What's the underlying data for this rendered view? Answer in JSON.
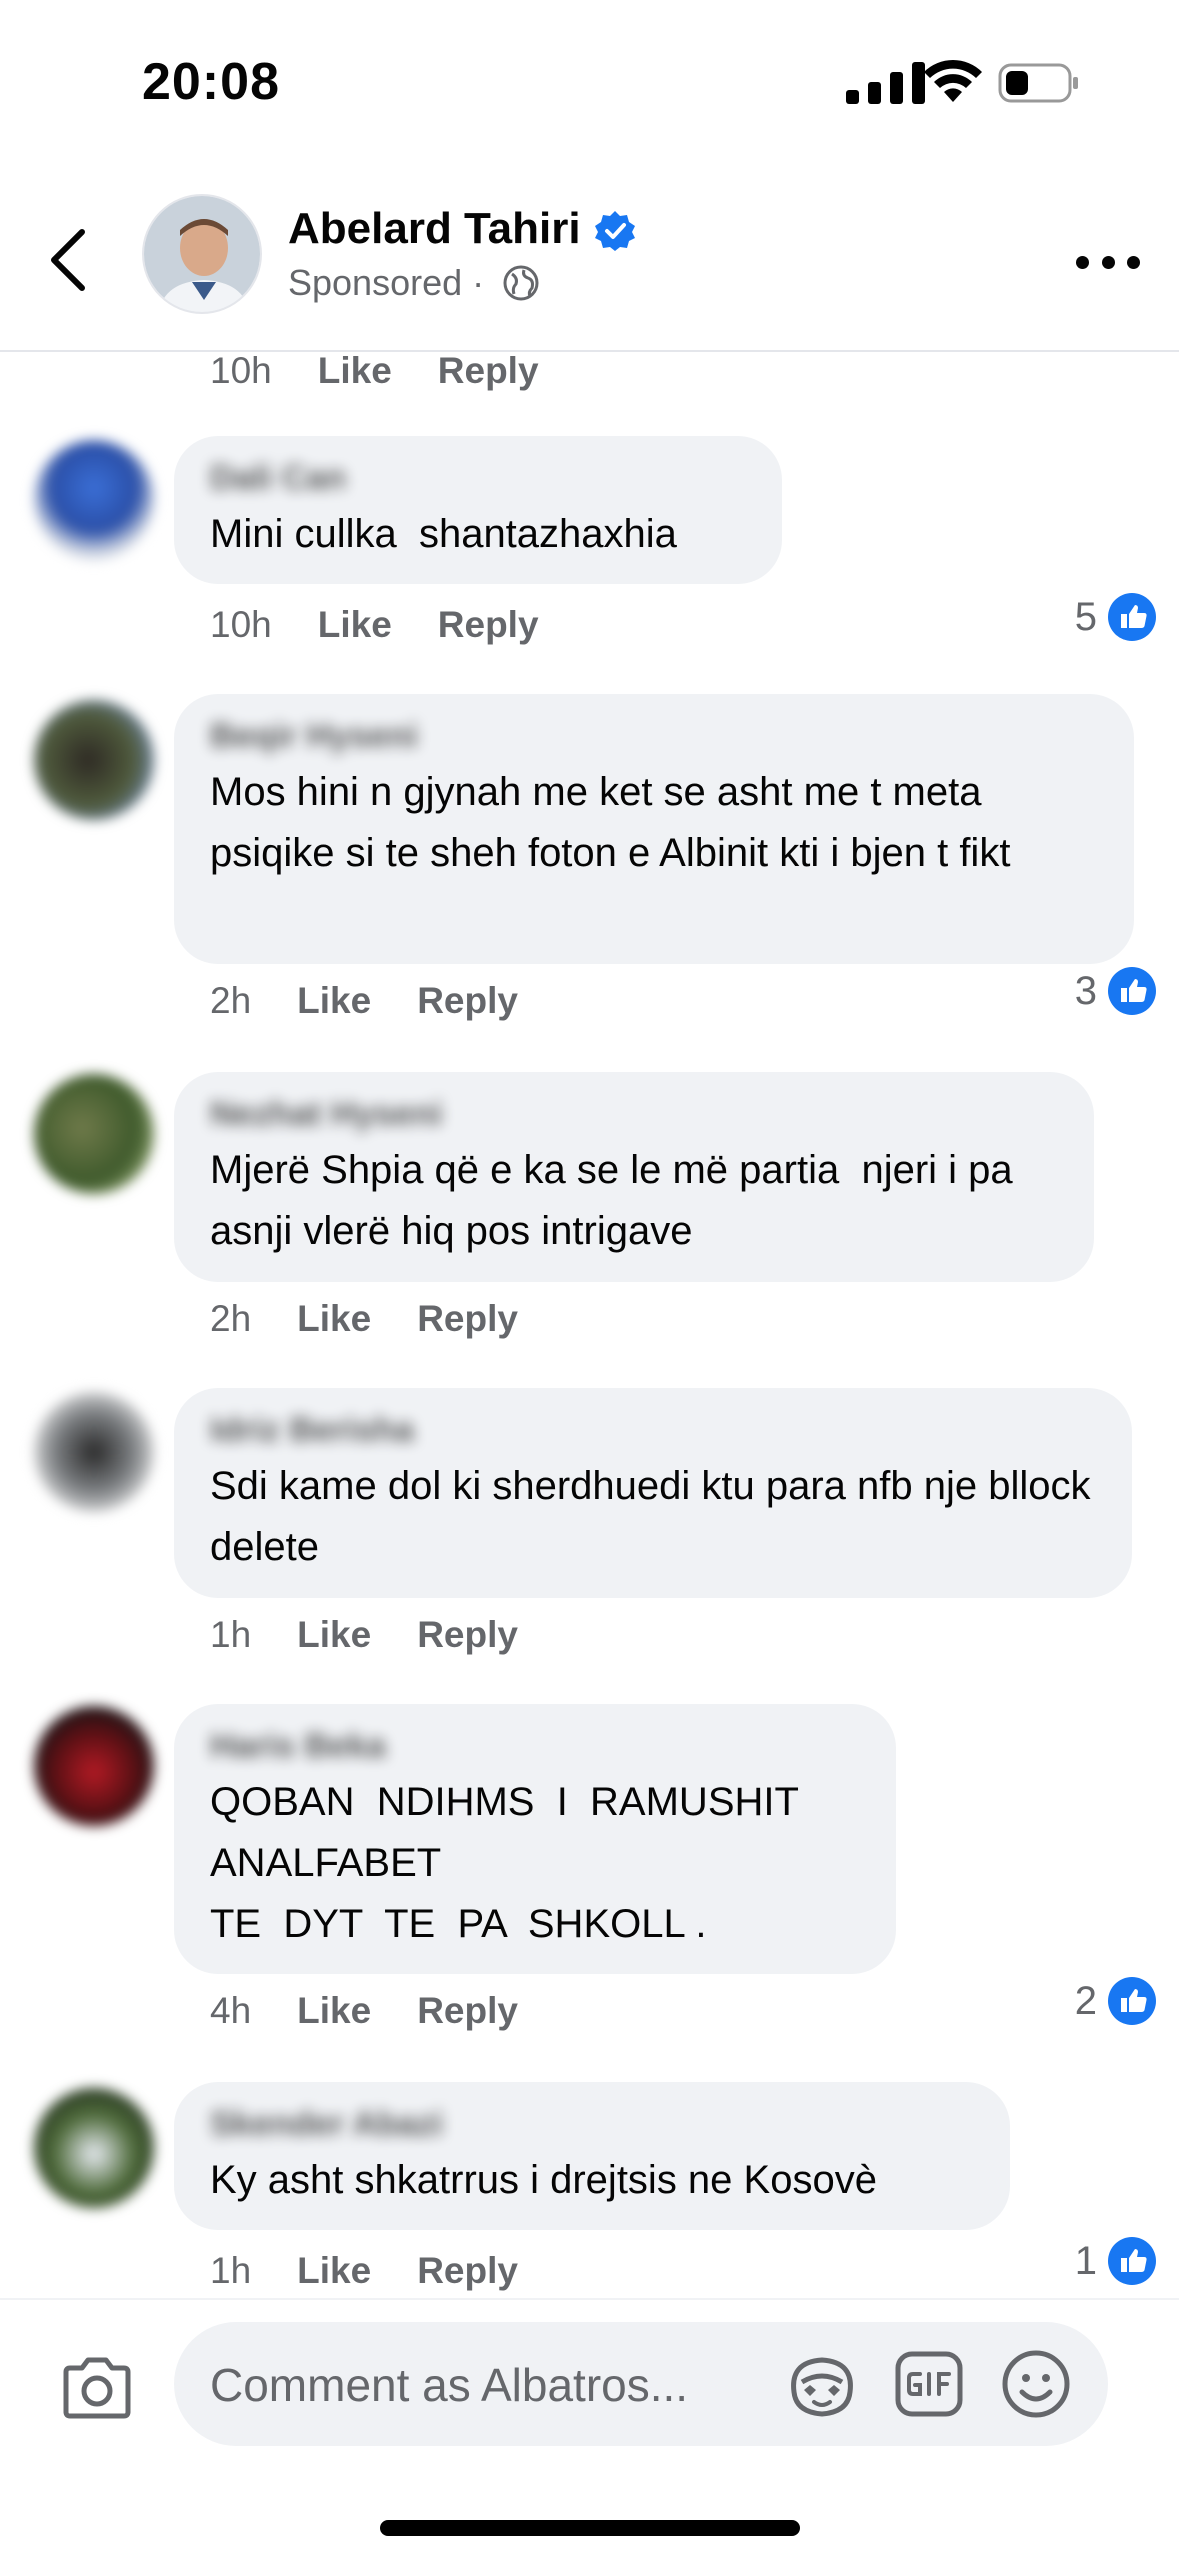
{
  "status_bar": {
    "time": "20:08"
  },
  "post_header": {
    "page_name": "Abelard Tahiri",
    "sponsored_label": "Sponsored",
    "separator": "·"
  },
  "top_meta": {
    "time": "10h",
    "like": "Like",
    "reply": "Reply"
  },
  "comments": [
    {
      "author": "Dali Can",
      "text": "Mini cullka  shantazhaxhia",
      "time": "10h",
      "like": "Like",
      "reply": "Reply",
      "reactions": "5"
    },
    {
      "author": "Beqir Hyseni",
      "text": "Mos hini n gjynah me ket se asht me t meta psiqike si te sheh foton e Albinit kti i bjen t fikt",
      "time": "2h",
      "like": "Like",
      "reply": "Reply",
      "reactions": "3"
    },
    {
      "author": "Nezhat Hyseni",
      "text": "Mjerë Shpia që e ka se le më partia  njeri i pa asnji vlerë hiq pos intrigave",
      "time": "2h",
      "like": "Like",
      "reply": "Reply",
      "reactions": ""
    },
    {
      "author": "Idriz Berisha",
      "text": "Sdi kame dol ki sherdhuedi ktu para nfb nje bllock delete",
      "time": "1h",
      "like": "Like",
      "reply": "Reply",
      "reactions": ""
    },
    {
      "author": "Haris Beka",
      "text": "QOBAN  NDIHMS  I  RAMUSHIT\nANALFABET\nTE  DYT  TE  PA  SHKOLL .",
      "time": "4h",
      "like": "Like",
      "reply": "Reply",
      "reactions": "2"
    },
    {
      "author": "Skender Abazi",
      "text": "Ky asht shkatrrus i drejtsis ne Kosovè",
      "time": "1h",
      "like": "Like",
      "reply": "Reply",
      "reactions": "1"
    }
  ],
  "composer": {
    "placeholder": "Comment as Albatros..."
  },
  "colors": {
    "accent": "#1877f2",
    "bubble": "#f0f2f5",
    "secondary_text": "#65676b"
  }
}
